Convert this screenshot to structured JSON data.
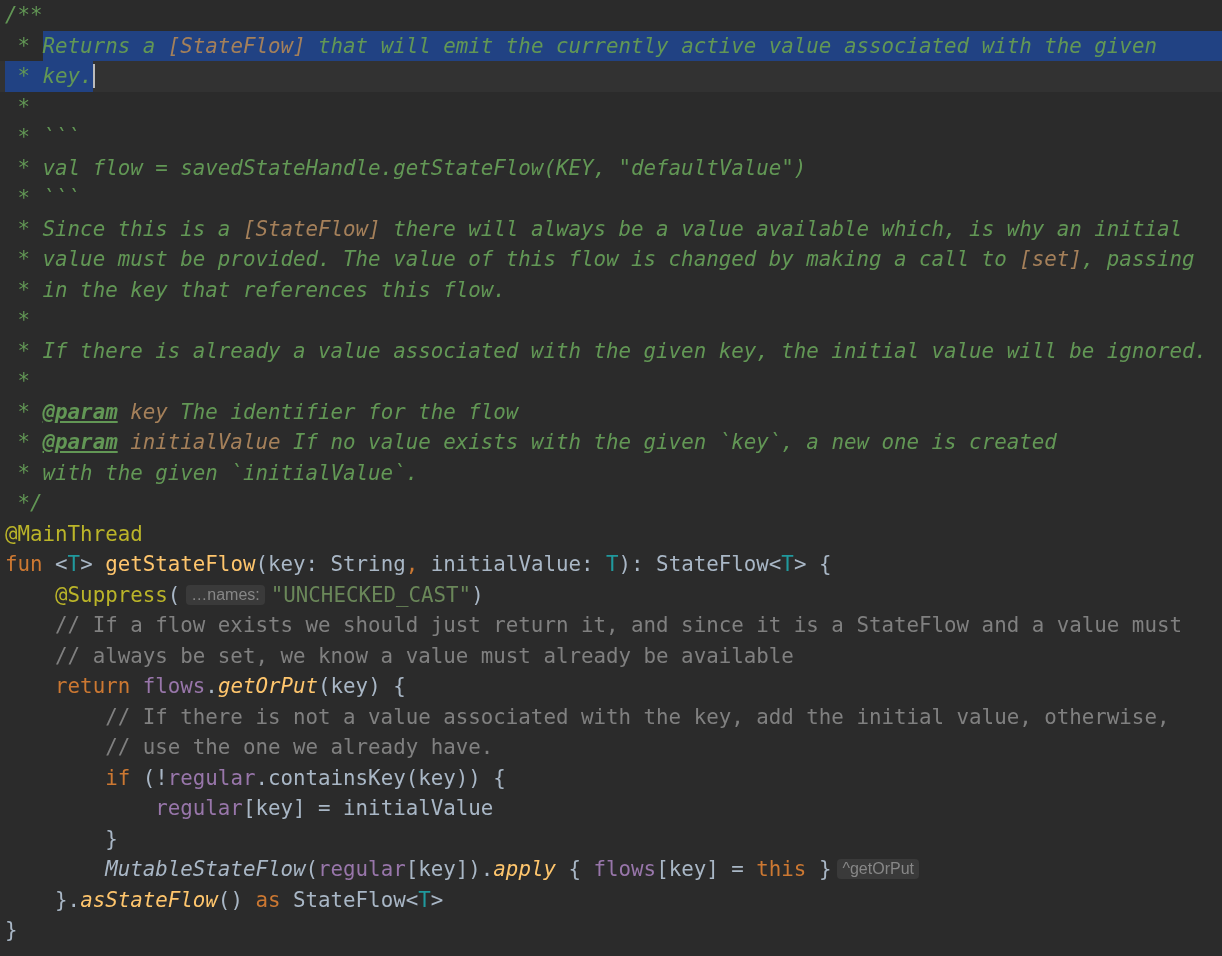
{
  "editor": {
    "lines": [
      {
        "tokens": [
          {
            "text": "/**",
            "kind": "doc"
          }
        ]
      },
      {
        "current": false,
        "eol_selected": true,
        "tokens": [
          {
            "text": " * ",
            "kind": "doc",
            "selected": false
          },
          {
            "text": "Returns a ",
            "kind": "doc",
            "selected": true
          },
          {
            "text": "[StateFlow]",
            "kind": "doclink",
            "selected": true
          },
          {
            "text": " that will emit the currently active value associated with the given",
            "kind": "doc",
            "selected": true
          }
        ]
      },
      {
        "current": true,
        "eol_selected": false,
        "tokens": [
          {
            "text": " * key.",
            "kind": "doc",
            "selected": true
          }
        ]
      },
      {
        "tokens": [
          {
            "text": " *",
            "kind": "doc"
          }
        ]
      },
      {
        "tokens": [
          {
            "text": " * ```",
            "kind": "doc"
          }
        ]
      },
      {
        "tokens": [
          {
            "text": " * val flow = savedStateHandle.getStateFlow(KEY, \"defaultValue\")",
            "kind": "doc"
          }
        ]
      },
      {
        "tokens": [
          {
            "text": " * ```",
            "kind": "doc"
          }
        ]
      },
      {
        "tokens": [
          {
            "text": " * Since this is a ",
            "kind": "doc"
          },
          {
            "text": "[StateFlow]",
            "kind": "doclink"
          },
          {
            "text": " there will always be a value available which, is why an initial",
            "kind": "doc"
          }
        ]
      },
      {
        "tokens": [
          {
            "text": " * value must be provided. The value of this flow is changed by making a call to ",
            "kind": "doc"
          },
          {
            "text": "[set]",
            "kind": "doclink"
          },
          {
            "text": ", passing",
            "kind": "doc"
          }
        ]
      },
      {
        "tokens": [
          {
            "text": " * in the key that references this flow.",
            "kind": "doc"
          }
        ]
      },
      {
        "tokens": [
          {
            "text": " *",
            "kind": "doc"
          }
        ]
      },
      {
        "tokens": [
          {
            "text": " * If there is already a value associated with the given key, the initial value will be ignored.",
            "kind": "doc"
          }
        ]
      },
      {
        "tokens": [
          {
            "text": " *",
            "kind": "doc"
          }
        ]
      },
      {
        "tokens": [
          {
            "text": " * ",
            "kind": "doc"
          },
          {
            "text": "@param",
            "kind": "doctag"
          },
          {
            "text": " key",
            "kind": "docparam"
          },
          {
            "text": " The identifier for the flow",
            "kind": "doc"
          }
        ]
      },
      {
        "tokens": [
          {
            "text": " * ",
            "kind": "doc"
          },
          {
            "text": "@param",
            "kind": "doctag"
          },
          {
            "text": " initialValue",
            "kind": "docparam"
          },
          {
            "text": " If no value exists with the given `key`, a new one is created",
            "kind": "doc"
          }
        ]
      },
      {
        "tokens": [
          {
            "text": " * with the given `initialValue`.",
            "kind": "doc"
          }
        ]
      },
      {
        "tokens": [
          {
            "text": " */",
            "kind": "doc"
          }
        ]
      },
      {
        "tokens": [
          {
            "text": "@MainThread",
            "kind": "annotation"
          }
        ]
      },
      {
        "tokens": [
          {
            "text": "fun",
            "kind": "keyword"
          },
          {
            "text": " <",
            "kind": "plain"
          },
          {
            "text": "T",
            "kind": "typeparam"
          },
          {
            "text": "> ",
            "kind": "plain"
          },
          {
            "text": "getStateFlow",
            "kind": "function"
          },
          {
            "text": "(key: String",
            "kind": "plain"
          },
          {
            "text": ",",
            "kind": "keyword"
          },
          {
            "text": " initialValue: ",
            "kind": "plain"
          },
          {
            "text": "T",
            "kind": "typeparam"
          },
          {
            "text": "): StateFlow<",
            "kind": "plain"
          },
          {
            "text": "T",
            "kind": "typeparam"
          },
          {
            "text": "> {",
            "kind": "plain"
          }
        ]
      },
      {
        "tokens": [
          {
            "text": "    @Suppress",
            "kind": "annotation"
          },
          {
            "text": "(",
            "kind": "plain"
          },
          {
            "text": "…names:",
            "kind": "hint"
          },
          {
            "text": "\"UNCHECKED_CAST\"",
            "kind": "string"
          },
          {
            "text": ")",
            "kind": "plain"
          }
        ]
      },
      {
        "tokens": [
          {
            "text": "    // If a flow exists we should just return it, and since it is a StateFlow and a value must",
            "kind": "comment"
          }
        ]
      },
      {
        "tokens": [
          {
            "text": "    // always be set, we know a value must already be available",
            "kind": "comment"
          }
        ]
      },
      {
        "tokens": [
          {
            "text": "    return ",
            "kind": "keyword"
          },
          {
            "text": "flows",
            "kind": "property"
          },
          {
            "text": ".",
            "kind": "plain"
          },
          {
            "text": "getOrPut",
            "kind": "extension"
          },
          {
            "text": "(key) {",
            "kind": "plain"
          }
        ]
      },
      {
        "tokens": [
          {
            "text": "        // If there is not a value associated with the key, add the initial value, otherwise,",
            "kind": "comment"
          }
        ]
      },
      {
        "tokens": [
          {
            "text": "        // use the one we already have.",
            "kind": "comment"
          }
        ]
      },
      {
        "tokens": [
          {
            "text": "        if",
            "kind": "keyword"
          },
          {
            "text": " (!",
            "kind": "plain"
          },
          {
            "text": "regular",
            "kind": "property"
          },
          {
            "text": ".containsKey(key)) {",
            "kind": "plain"
          }
        ]
      },
      {
        "tokens": [
          {
            "text": "            regular",
            "kind": "property"
          },
          {
            "text": "[key] = initialValue",
            "kind": "plain"
          }
        ]
      },
      {
        "tokens": [
          {
            "text": "        }",
            "kind": "plain"
          }
        ]
      },
      {
        "tokens": [
          {
            "text": "        MutableStateFlow",
            "kind": "italic"
          },
          {
            "text": "(",
            "kind": "plain"
          },
          {
            "text": "regular",
            "kind": "property"
          },
          {
            "text": "[key]).",
            "kind": "plain"
          },
          {
            "text": "apply",
            "kind": "extension"
          },
          {
            "text": " { ",
            "kind": "plain"
          },
          {
            "text": "flows",
            "kind": "property"
          },
          {
            "text": "[key] = ",
            "kind": "plain"
          },
          {
            "text": "this",
            "kind": "keyword"
          },
          {
            "text": " }",
            "kind": "plain"
          },
          {
            "text": "^getOrPut",
            "kind": "hint"
          }
        ]
      },
      {
        "tokens": [
          {
            "text": "    }.",
            "kind": "plain"
          },
          {
            "text": "asStateFlow",
            "kind": "extension"
          },
          {
            "text": "() ",
            "kind": "plain"
          },
          {
            "text": "as",
            "kind": "keyword"
          },
          {
            "text": " StateFlow<",
            "kind": "plain"
          },
          {
            "text": "T",
            "kind": "typeparam"
          },
          {
            "text": ">",
            "kind": "plain"
          }
        ]
      },
      {
        "tokens": [
          {
            "text": "}",
            "kind": "plain"
          }
        ]
      }
    ]
  }
}
